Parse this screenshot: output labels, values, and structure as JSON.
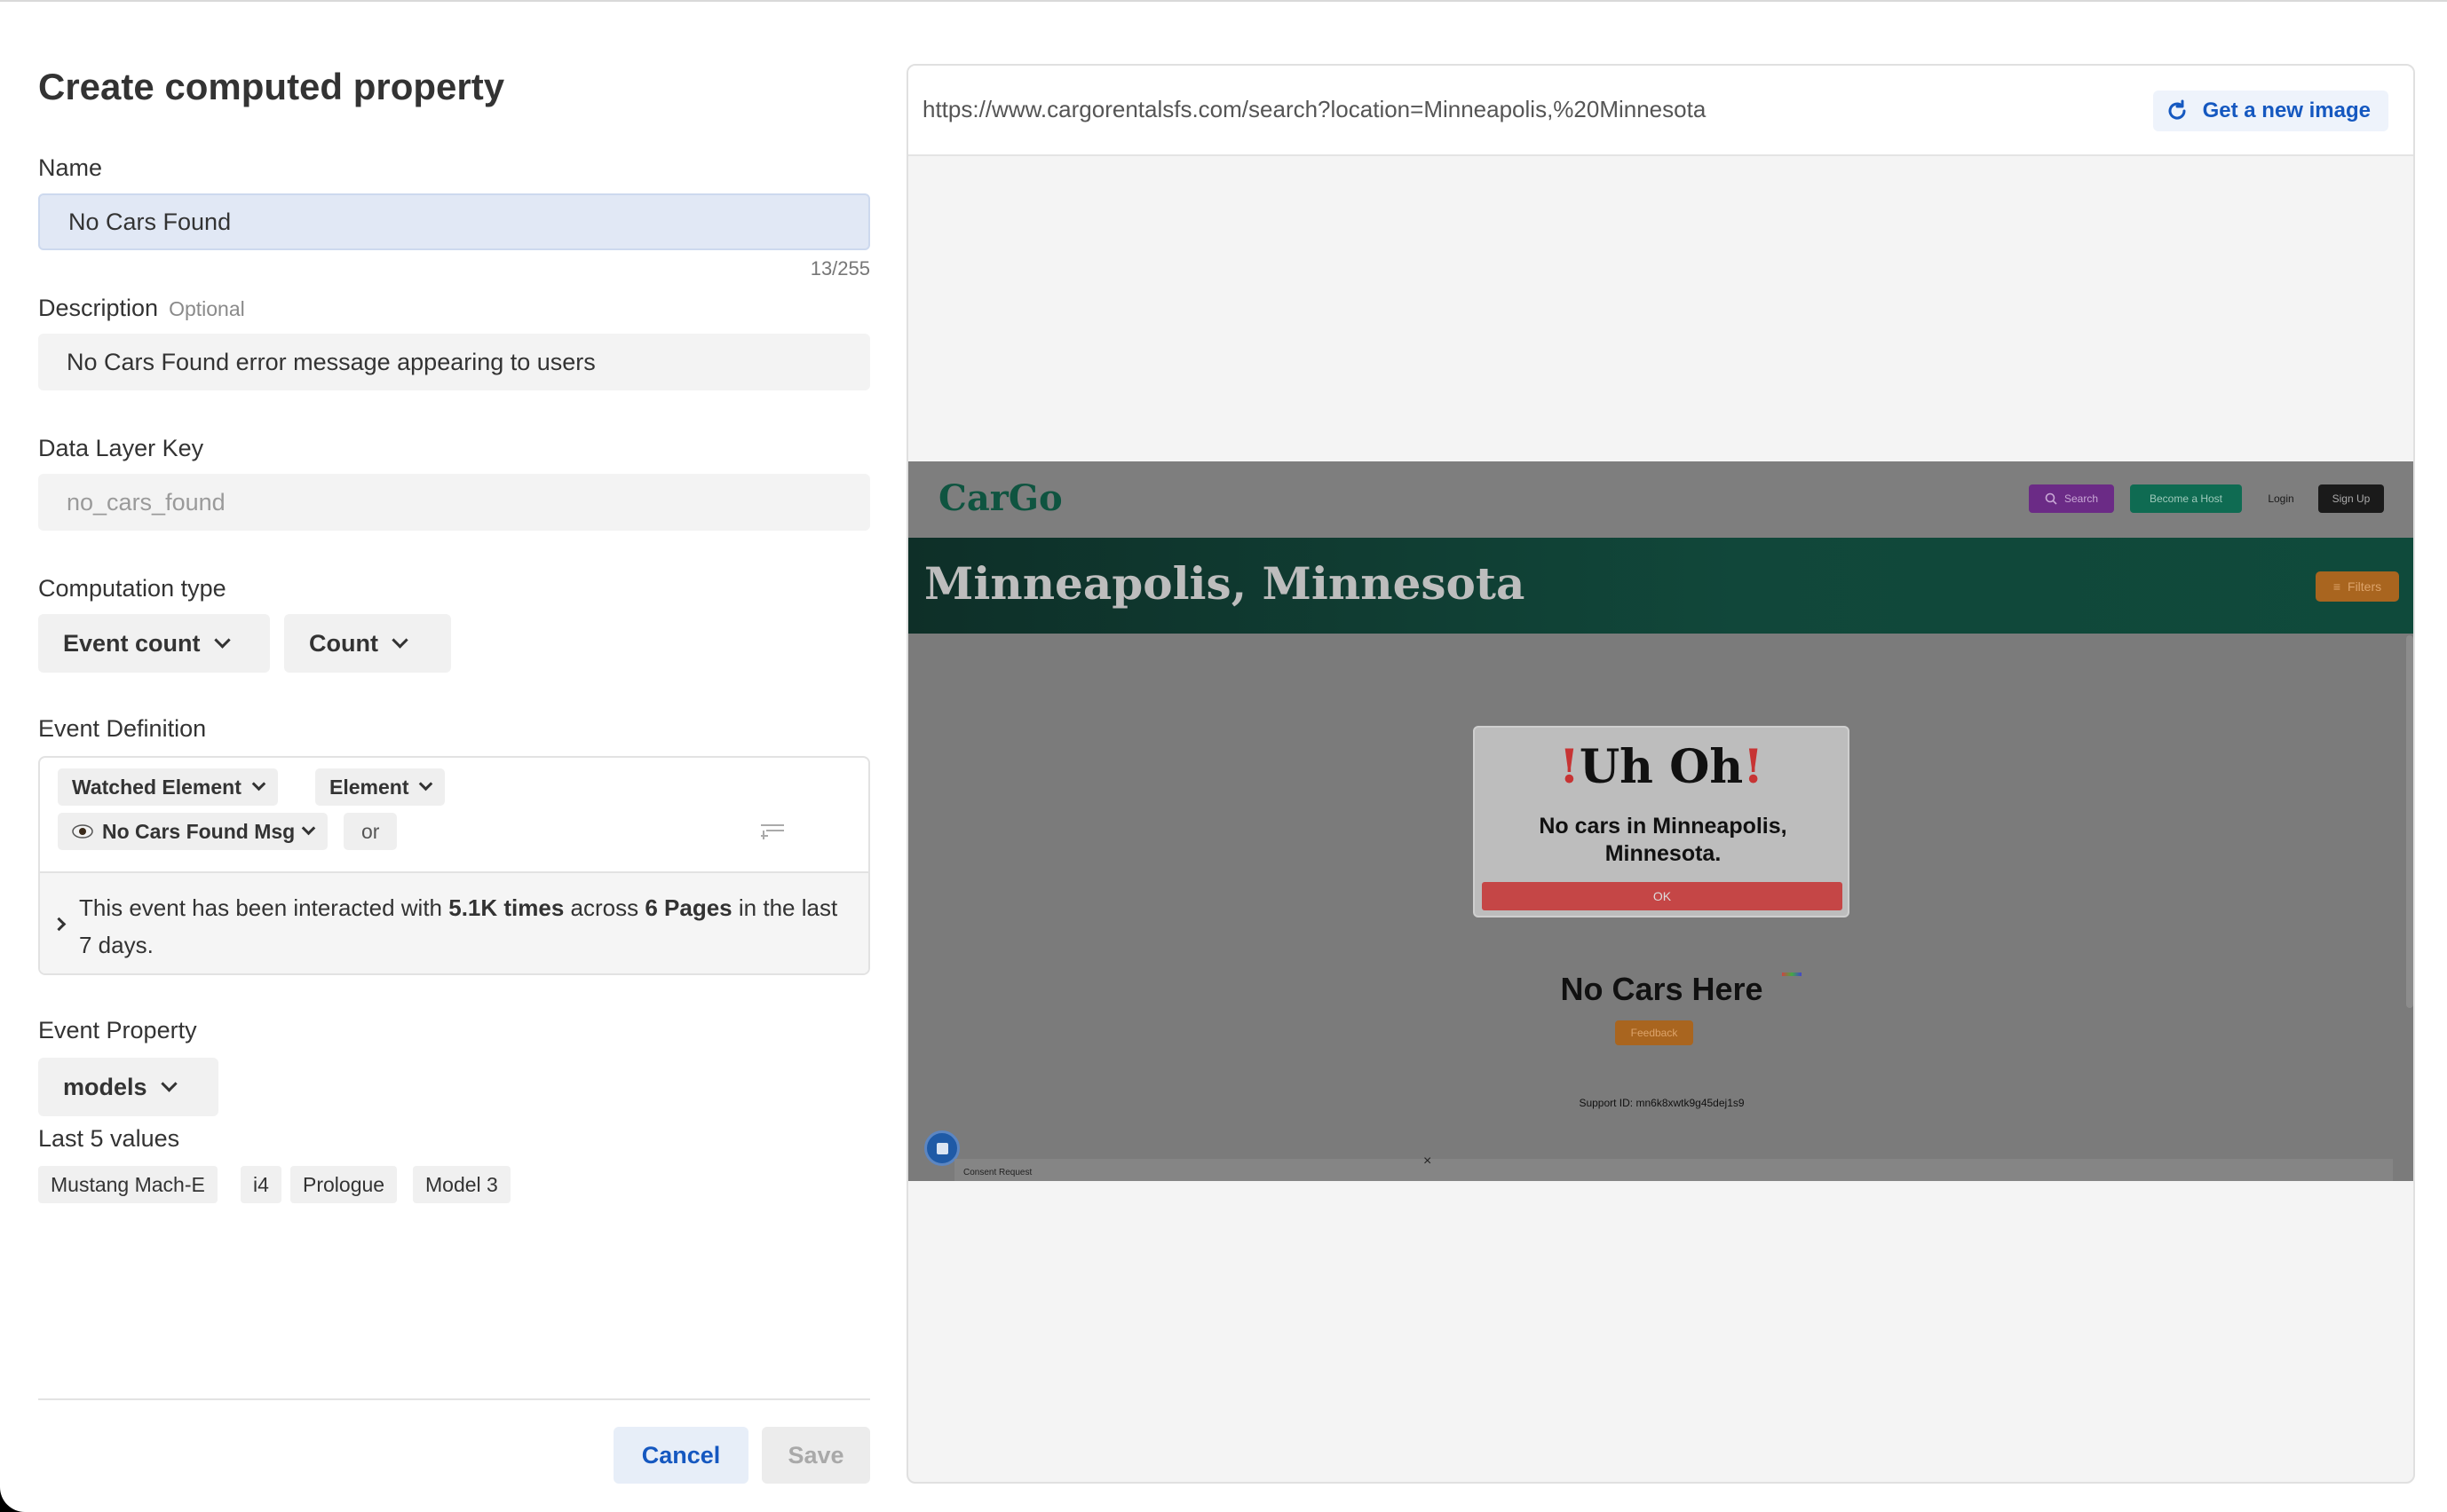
{
  "dialog": {
    "title": "Create computed property",
    "name": {
      "label": "Name",
      "value": "No Cars Found",
      "counter": "13/255"
    },
    "description": {
      "label": "Description",
      "optional": "Optional",
      "value": "No Cars Found error message appearing to users"
    },
    "data_layer_key": {
      "label": "Data Layer Key",
      "placeholder": "no_cars_found"
    },
    "computation_type": {
      "label": "Computation type",
      "type": "Event count",
      "aggregation": "Count"
    },
    "event_definition": {
      "label": "Event Definition",
      "element_type": "Watched Element",
      "element_kind": "Element",
      "watched": "No Cars Found Msg",
      "or_label": "or",
      "info": {
        "prefix": "This event has been interacted with ",
        "times": "5.1K times",
        "middle": " across ",
        "pages": "6 Pages",
        "suffix": " in the last 7 days."
      }
    },
    "event_property": {
      "label": "Event Property",
      "value": "models",
      "last_values_label": "Last 5 values",
      "last_values": [
        "Mustang Mach-E",
        "i4",
        "Prologue",
        "Model 3"
      ]
    },
    "buttons": {
      "cancel": "Cancel",
      "save": "Save"
    }
  },
  "preview": {
    "url": "https://www.cargorentalsfs.com/search?location=Minneapolis,%20Minnesota",
    "new_image_label": "Get a new image",
    "site": {
      "logo": "CarGo",
      "nav": {
        "search": "Search",
        "host": "Become a Host",
        "login": "Login",
        "signup": "Sign Up"
      },
      "city": "Minneapolis, Minnesota",
      "filters": "Filters",
      "modal": {
        "title": "Uh Oh",
        "exclaim": "!",
        "message": "No cars in Minneapolis, Minnesota.",
        "ok": "OK"
      },
      "no_cars": "No Cars Here",
      "feedback": "Feedback",
      "support": "Support ID: mn6k8xwtk9g45dej1s9",
      "consent": "Consent Request"
    }
  },
  "colors": {
    "accent": "#1558c0",
    "brand_green": "#0f5440",
    "error_red": "#c54646"
  }
}
